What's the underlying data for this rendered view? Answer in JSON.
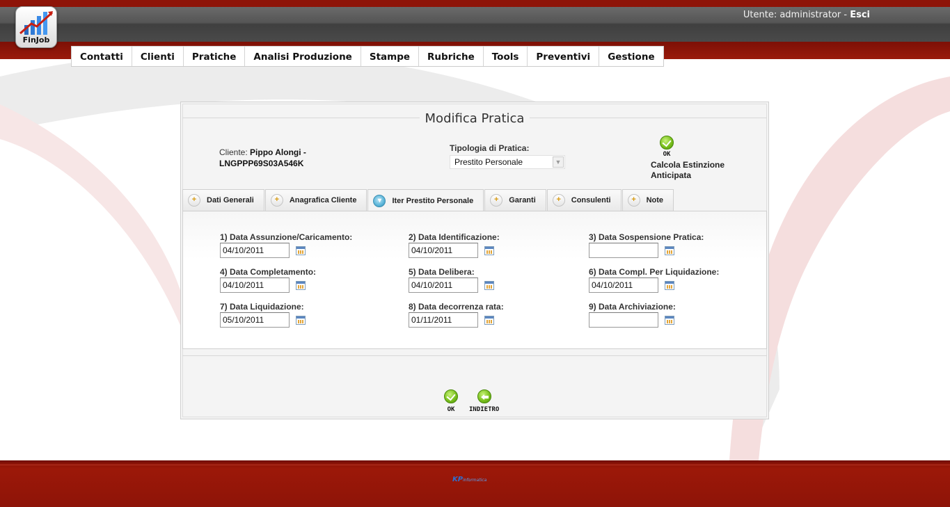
{
  "app": {
    "logo_text": "FinJob",
    "user_label": "Utente: administrator - ",
    "logout_label": "Esci"
  },
  "menu": [
    {
      "label": "Contatti"
    },
    {
      "label": "Clienti"
    },
    {
      "label": "Pratiche"
    },
    {
      "label": "Analisi Produzione"
    },
    {
      "label": "Stampe"
    },
    {
      "label": "Rubriche"
    },
    {
      "label": "Tools"
    },
    {
      "label": "Preventivi"
    },
    {
      "label": "Gestione"
    }
  ],
  "form": {
    "title": "Modifica Pratica",
    "client_label": "Cliente: ",
    "client_name": "Pippo Alongi -",
    "client_code": "LNGPPP69S03A546K",
    "tipologia_label": "Tipologia di Pratica:",
    "tipologia_value": "Prestito Personale",
    "calc_ok_label": "OK",
    "calc_label_1": "Calcola Estinzione",
    "calc_label_2": "Anticipata"
  },
  "tabs": [
    {
      "label": "Dati Generali",
      "active": false
    },
    {
      "label": "Anagrafica Cliente",
      "active": false
    },
    {
      "label": "Iter Prestito Personale",
      "active": true
    },
    {
      "label": "Garanti",
      "active": false
    },
    {
      "label": "Consulenti",
      "active": false
    },
    {
      "label": "Note",
      "active": false
    }
  ],
  "fields": [
    {
      "label": "1) Data Assunzione/Caricamento:",
      "value": "04/10/2011"
    },
    {
      "label": "2) Data Identificazione:",
      "value": "04/10/2011"
    },
    {
      "label": "3) Data Sospensione Pratica:",
      "value": ""
    },
    {
      "label": "4) Data Completamento:",
      "value": "04/10/2011"
    },
    {
      "label": "5) Data Delibera:",
      "value": "04/10/2011"
    },
    {
      "label": "6) Data Compl. Per Liquidazione:",
      "value": "04/10/2011"
    },
    {
      "label": "7) Data Liquidazione:",
      "value": "05/10/2011"
    },
    {
      "label": "8) Data decorrenza rata:",
      "value": "01/11/2011"
    },
    {
      "label": "9) Data Archiviazione:",
      "value": ""
    }
  ],
  "actions": {
    "ok_label": "OK",
    "back_label": "INDIETRO"
  },
  "footer": {
    "logo_text": "KP",
    "logo_sub": "informatica"
  },
  "colors": {
    "header_red": "#8e1408",
    "header_gray": "#4a4a4a",
    "accent_green": "#7bc11e"
  }
}
